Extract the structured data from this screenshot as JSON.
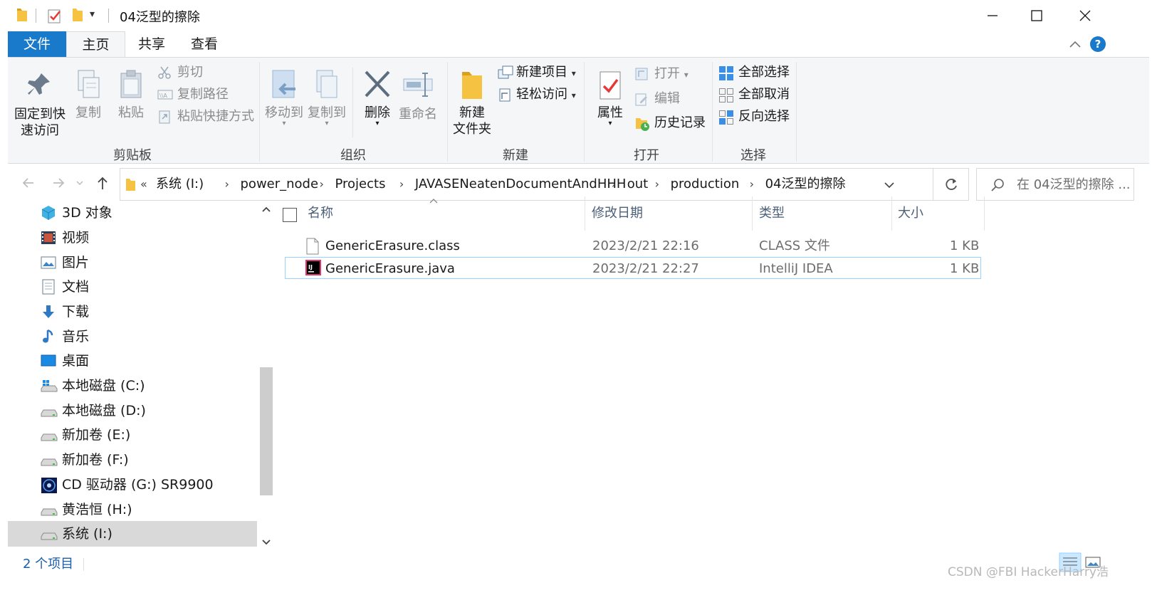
{
  "window": {
    "title": "04泛型的擦除",
    "quick_access_down": "▾"
  },
  "tabs": {
    "file": "文件",
    "home": "主页",
    "share": "共享",
    "view": "查看"
  },
  "ribbon": {
    "clipboard": {
      "group_label": "剪贴板",
      "pin_label_1": "固定到快",
      "pin_label_2": "速访问",
      "copy": "复制",
      "paste": "粘贴",
      "cut": "剪切",
      "copy_path": "复制路径",
      "paste_shortcut": "粘贴快捷方式"
    },
    "organize": {
      "group_label": "组织",
      "move_to": "移动到",
      "copy_to": "复制到",
      "delete": "删除",
      "rename": "重命名"
    },
    "new": {
      "group_label": "新建",
      "new_folder_1": "新建",
      "new_folder_2": "文件夹",
      "new_item": "新建项目",
      "easy_access": "轻松访问"
    },
    "open": {
      "group_label": "打开",
      "properties": "属性",
      "open": "打开",
      "edit": "编辑",
      "history": "历史记录"
    },
    "select": {
      "group_label": "选择",
      "select_all": "全部选择",
      "select_none": "全部取消",
      "invert": "反向选择"
    }
  },
  "address": {
    "overflow": "«",
    "crumbs": [
      "系统 (I:)",
      "power_node",
      "Projects",
      "JAVASENeatenDocumentAndHHH",
      "out",
      "production",
      "04泛型的擦除"
    ],
    "search_placeholder": "在 04泛型的擦除 ..."
  },
  "nav_pane": {
    "items": [
      "3D 对象",
      "视频",
      "图片",
      "文档",
      "下载",
      "音乐",
      "桌面",
      "本地磁盘 (C:)",
      "本地磁盘 (D:)",
      "新加卷 (E:)",
      "新加卷 (F:)",
      "CD 驱动器 (G:) SR9900",
      "黄浩恒 (H:)",
      "系统 (I:)"
    ],
    "selected_index": 13
  },
  "file_list": {
    "columns": {
      "name": "名称",
      "modified": "修改日期",
      "type": "类型",
      "size": "大小"
    },
    "rows": [
      {
        "name": "GenericErasure.class",
        "modified": "2023/2/21 22:16",
        "type": "CLASS 文件",
        "size": "1 KB"
      },
      {
        "name": "GenericErasure.java",
        "modified": "2023/2/21 22:27",
        "type": "IntelliJ IDEA",
        "size": "1 KB"
      }
    ]
  },
  "status": {
    "count": "2 个项目"
  },
  "watermark": "CSDN @FBI HackerHarry浩",
  "colors": {
    "accent": "#1979ca",
    "folder": "#f5c242",
    "selected_row_border": "#99d1ff"
  }
}
